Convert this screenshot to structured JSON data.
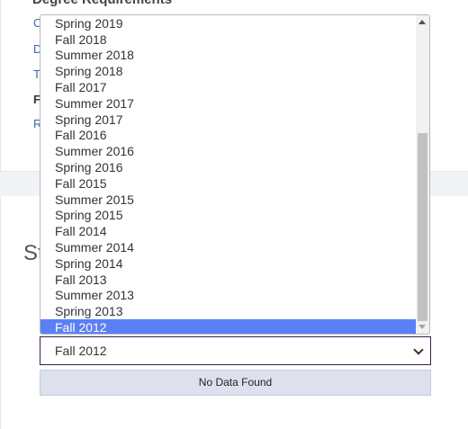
{
  "section": {
    "heading": "Degree Requirements"
  },
  "side_links": [
    {
      "label": "C"
    },
    {
      "label": "D"
    },
    {
      "label": "T"
    },
    {
      "label": "F"
    },
    {
      "label": "R"
    }
  ],
  "page": {
    "heading_partial": "St"
  },
  "term_dropdown": {
    "options": [
      "Spring 2019",
      "Fall 2018",
      "Summer 2018",
      "Spring 2018",
      "Fall 2017",
      "Summer 2017",
      "Spring 2017",
      "Fall 2016",
      "Summer 2016",
      "Spring 2016",
      "Fall 2015",
      "Summer 2015",
      "Spring 2015",
      "Fall 2014",
      "Summer 2014",
      "Spring 2014",
      "Fall 2013",
      "Summer 2013",
      "Spring 2013",
      "Fall 2012"
    ],
    "highlighted": "Fall 2012",
    "selected_value": "Fall 2012",
    "highlight_color": "#5b7ff5"
  },
  "results": {
    "message": "No Data Found"
  }
}
